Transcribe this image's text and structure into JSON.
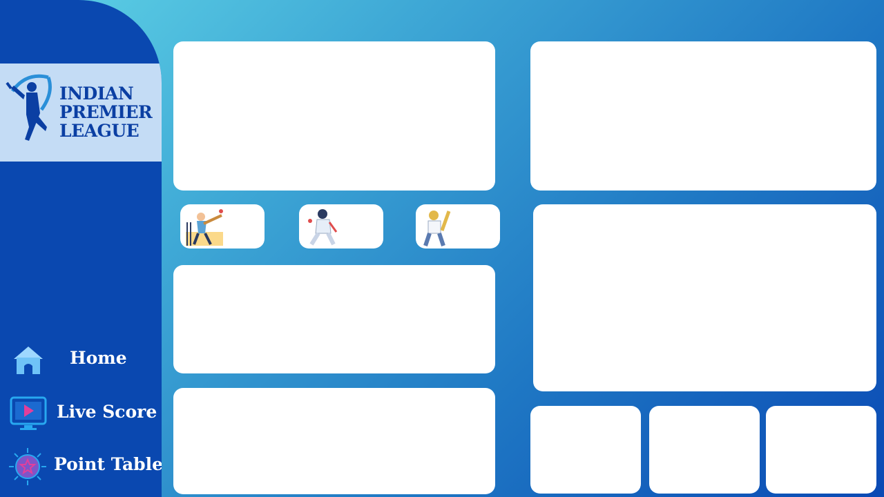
{
  "brand": {
    "logo_lines": [
      "INDIAN",
      "PREMIER",
      "LEAGUE"
    ]
  },
  "nav": {
    "home": "Home",
    "live_score": "Live Score",
    "point_table": "Point Table"
  },
  "colors": {
    "sidebar": "#0a48b0",
    "logo_panel": "#c4dcf5",
    "card": "#ffffff"
  }
}
